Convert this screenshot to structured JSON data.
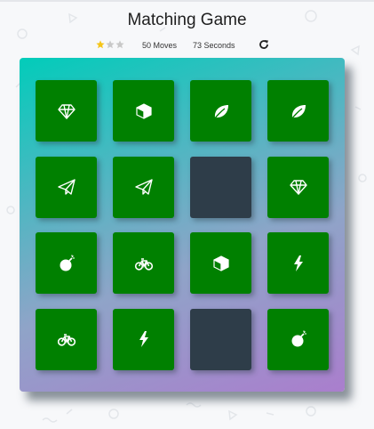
{
  "game": {
    "title": "Matching Game",
    "rating": {
      "earned": 1,
      "total": 3
    },
    "moves_label": "50 Moves",
    "timer_label": "73 Seconds",
    "restart_icon": "restart-icon"
  },
  "deck": {
    "colors": {
      "matched": "#008000",
      "hidden": "#2e3d49",
      "icon": "#ffffff",
      "star_on": "#f5c518",
      "star_off": "#c8c8c8"
    },
    "cards": [
      {
        "icon": "diamond",
        "state": "matched"
      },
      {
        "icon": "cube",
        "state": "matched"
      },
      {
        "icon": "leaf",
        "state": "matched"
      },
      {
        "icon": "leaf",
        "state": "matched"
      },
      {
        "icon": "paper-plane",
        "state": "matched"
      },
      {
        "icon": "paper-plane",
        "state": "matched"
      },
      {
        "icon": "",
        "state": "hidden"
      },
      {
        "icon": "diamond",
        "state": "matched"
      },
      {
        "icon": "bomb",
        "state": "matched"
      },
      {
        "icon": "bicycle",
        "state": "matched"
      },
      {
        "icon": "cube",
        "state": "matched"
      },
      {
        "icon": "bolt",
        "state": "matched"
      },
      {
        "icon": "bicycle",
        "state": "matched"
      },
      {
        "icon": "bolt",
        "state": "matched"
      },
      {
        "icon": "",
        "state": "hidden"
      },
      {
        "icon": "bomb",
        "state": "matched"
      }
    ]
  }
}
